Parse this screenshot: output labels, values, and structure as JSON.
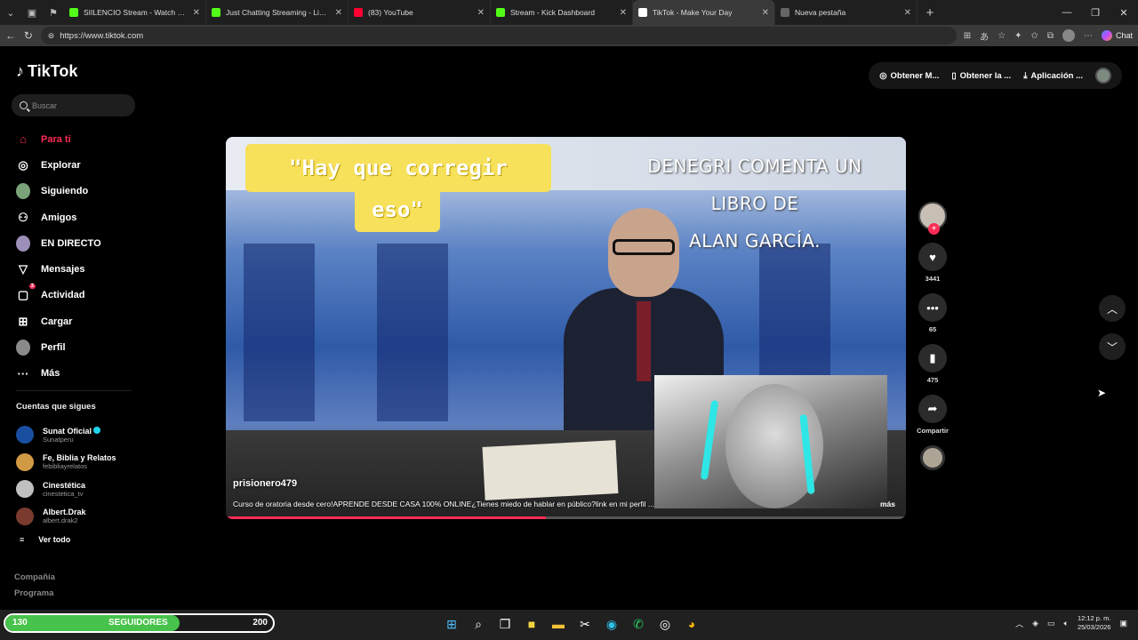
{
  "browser": {
    "tabs": [
      {
        "title": "SIILENCIO Stream - Watch Live on",
        "color": "#53fc18",
        "active": false
      },
      {
        "title": "Just Chatting Streaming - Live Stre",
        "color": "#53fc18",
        "active": false
      },
      {
        "title": "(83) YouTube",
        "color": "#ff0033",
        "active": false
      },
      {
        "title": "Stream - Kick Dashboard",
        "color": "#53fc18",
        "active": false
      },
      {
        "title": "TikTok - Make Your Day",
        "color": "#ffffff",
        "active": true
      },
      {
        "title": "Nueva pestaña",
        "color": "#666666",
        "active": false
      }
    ],
    "url": "https://www.tiktok.com",
    "copilot_label": "Chat"
  },
  "tiktok": {
    "logo": "TikTok",
    "search_placeholder": "Buscar",
    "menu": [
      {
        "label": "Para ti",
        "icon": "home-icon",
        "active": true
      },
      {
        "label": "Explorar",
        "icon": "compass-icon",
        "active": false
      },
      {
        "label": "Siguiendo",
        "icon": "following-avatar",
        "active": false
      },
      {
        "label": "Amigos",
        "icon": "friends-icon",
        "active": false
      },
      {
        "label": "EN DIRECTO",
        "icon": "live-avatar",
        "active": false
      },
      {
        "label": "Mensajes",
        "icon": "send-icon",
        "active": false
      },
      {
        "label": "Actividad",
        "icon": "activity-icon",
        "active": false,
        "badge": "3"
      },
      {
        "label": "Cargar",
        "icon": "upload-icon",
        "active": false
      },
      {
        "label": "Perfil",
        "icon": "profile-avatar",
        "active": false
      },
      {
        "label": "Más",
        "icon": "more-icon",
        "active": false
      }
    ],
    "following_title": "Cuentas que sigues",
    "following": [
      {
        "name": "Sunat Oficial",
        "handle": "Sunatperu",
        "verified": true,
        "color": "#1a4fa0"
      },
      {
        "name": "Fe, Biblia y Relatos",
        "handle": "febibliayrelatos",
        "verified": false,
        "color": "#d19a45"
      },
      {
        "name": "Cinestética",
        "handle": "cinestetica_tv",
        "verified": false,
        "color": "#c0c0c0"
      },
      {
        "name": "Albert.Drak",
        "handle": "albert.drak2",
        "verified": false,
        "color": "#7a3b2e"
      }
    ],
    "see_all": "Ver todo",
    "footer_links": [
      "Compañía",
      "Programa"
    ],
    "top_buttons": [
      "Obtener M...",
      "Obtener la ...",
      "Aplicación ..."
    ],
    "video": {
      "caption_line1": "\"Hay que corregir",
      "caption_line2": "eso\"",
      "overlay_line1": "DENEGRI COMENTA UN LIBRO DE",
      "overlay_line2": "ALAN GARCÍA.",
      "author": "prisionero479",
      "description": "Curso de oratoria desde cero!APRENDE DESDE CASA 100% ONLINE¿Tienes miedo de hablar en público?link en mi perfil ...",
      "more": "más",
      "progress": 0.47
    },
    "actions": {
      "likes": "3441",
      "comments": "65",
      "saves": "475",
      "share_label": "Compartir"
    }
  },
  "overlay_bar": {
    "current": "130",
    "label": "SEGUIDORES",
    "goal": "200",
    "fraction": 0.65
  },
  "taskbar": {
    "time": "12:12 p. m.",
    "date": "25/03/2026"
  }
}
